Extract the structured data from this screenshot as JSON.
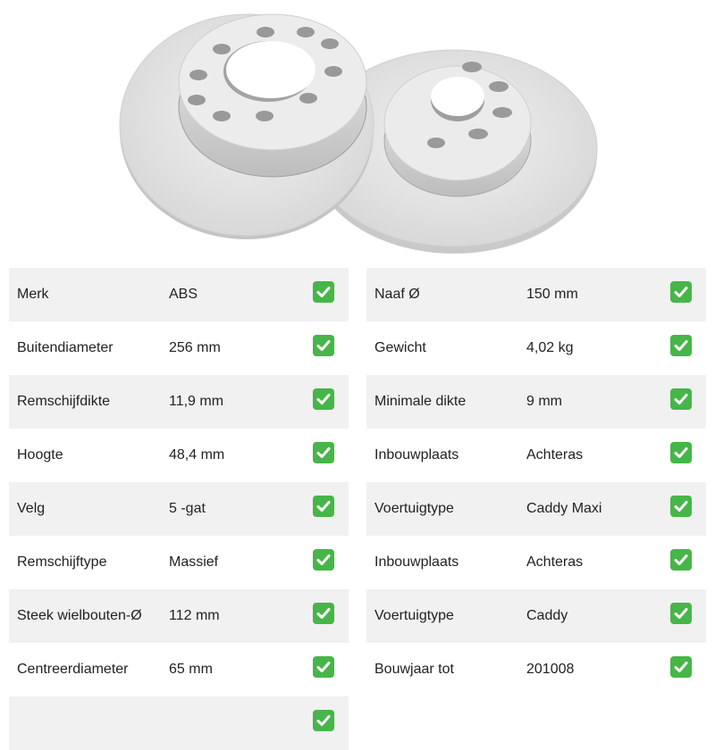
{
  "product": {
    "image_icon": "brake-disc-pair"
  },
  "specs": {
    "left": [
      {
        "label": "Merk",
        "value": "ABS"
      },
      {
        "label": "Buitendiameter",
        "value": "256 mm"
      },
      {
        "label": "Remschijfdikte",
        "value": "11,9 mm"
      },
      {
        "label": "Hoogte",
        "value": "48,4 mm"
      },
      {
        "label": "Velg",
        "value": "5 -gat"
      },
      {
        "label": "Remschijftype",
        "value": "Massief"
      },
      {
        "label": "Steek wielbouten-Ø",
        "value": "112 mm"
      },
      {
        "label": "Centreerdiameter",
        "value": "65 mm"
      },
      {
        "label": "",
        "value": ""
      }
    ],
    "right": [
      {
        "label": "Naaf Ø",
        "value": "150 mm"
      },
      {
        "label": "Gewicht",
        "value": "4,02 kg"
      },
      {
        "label": "Minimale dikte",
        "value": "9 mm"
      },
      {
        "label": "Inbouwplaats",
        "value": "Achteras"
      },
      {
        "label": "Voertuigtype",
        "value": "Caddy Maxi"
      },
      {
        "label": "Inbouwplaats",
        "value": "Achteras"
      },
      {
        "label": "Voertuigtype",
        "value": "Caddy"
      },
      {
        "label": "Bouwjaar tot",
        "value": "201008"
      }
    ],
    "check_icon": "check-mark-icon",
    "check_color": "#46b648",
    "row_alt_color": "#f1f1f1"
  }
}
